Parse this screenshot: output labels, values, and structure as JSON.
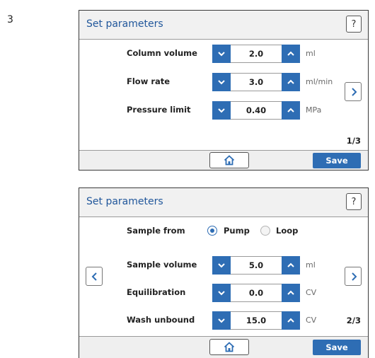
{
  "step_number": "3",
  "panel1": {
    "title": "Set parameters",
    "help_label": "?",
    "rows": [
      {
        "label": "Column volume",
        "value": "2.0",
        "unit": "ml"
      },
      {
        "label": "Flow rate",
        "value": "3.0",
        "unit": "ml/min"
      },
      {
        "label": "Pressure limit",
        "value": "0.40",
        "unit": "MPa"
      }
    ],
    "page_indicator": "1/3",
    "save_label": "Save"
  },
  "panel2": {
    "title": "Set parameters",
    "help_label": "?",
    "sample_from": {
      "label": "Sample from",
      "options": [
        "Pump",
        "Loop"
      ],
      "selected": "Pump"
    },
    "rows": [
      {
        "label": "Sample volume",
        "value": "5.0",
        "unit": "ml"
      },
      {
        "label": "Equilibration",
        "value": "0.0",
        "unit": "CV"
      },
      {
        "label": "Wash unbound",
        "value": "15.0",
        "unit": "CV"
      }
    ],
    "page_indicator": "2/3",
    "save_label": "Save"
  },
  "icons": {
    "decrement": "chevron-down-icon",
    "increment": "chevron-up-icon",
    "previous": "chevron-left-icon",
    "next": "chevron-right-icon",
    "home": "home-icon"
  },
  "colors": {
    "accent": "#2e6db4",
    "title": "#21579b",
    "header_bg": "#f1f1f1"
  }
}
